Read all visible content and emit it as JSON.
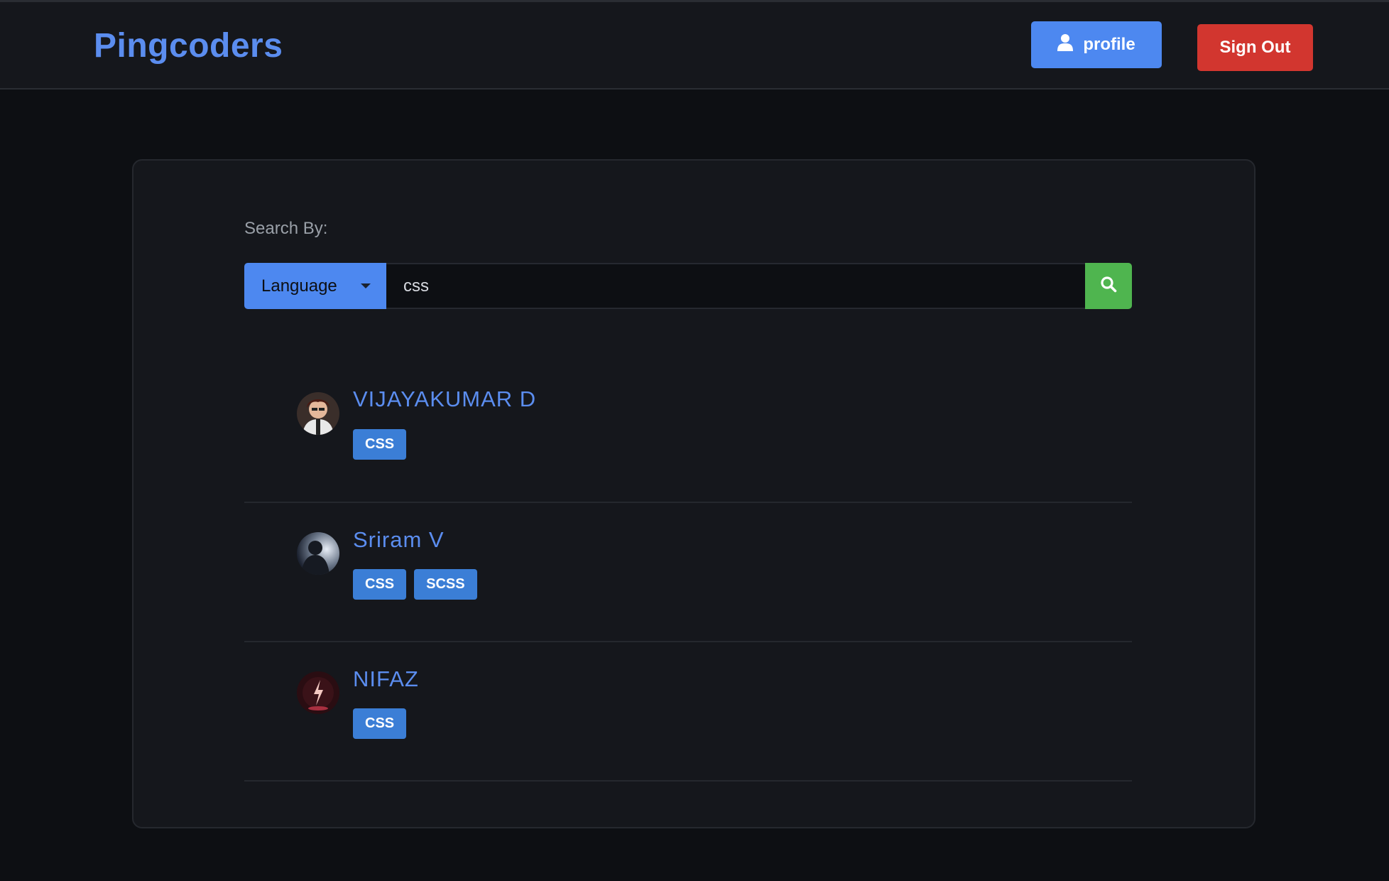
{
  "header": {
    "brand": "Pingcoders",
    "profile_label": "profile",
    "signout_label": "Sign Out"
  },
  "search": {
    "label": "Search By:",
    "filter_selected": "Language",
    "query": "css"
  },
  "results": [
    {
      "name": "VIJAYAKUMAR D",
      "tags": [
        "CSS"
      ]
    },
    {
      "name": "Sriram V",
      "tags": [
        "CSS",
        "SCSS"
      ]
    },
    {
      "name": "NIFAZ",
      "tags": [
        "CSS"
      ]
    }
  ],
  "colors": {
    "brand": "#5b8def",
    "primary": "#4d88f0",
    "danger": "#d2362f",
    "success": "#4fb54f",
    "tag": "#3b7ed6"
  }
}
